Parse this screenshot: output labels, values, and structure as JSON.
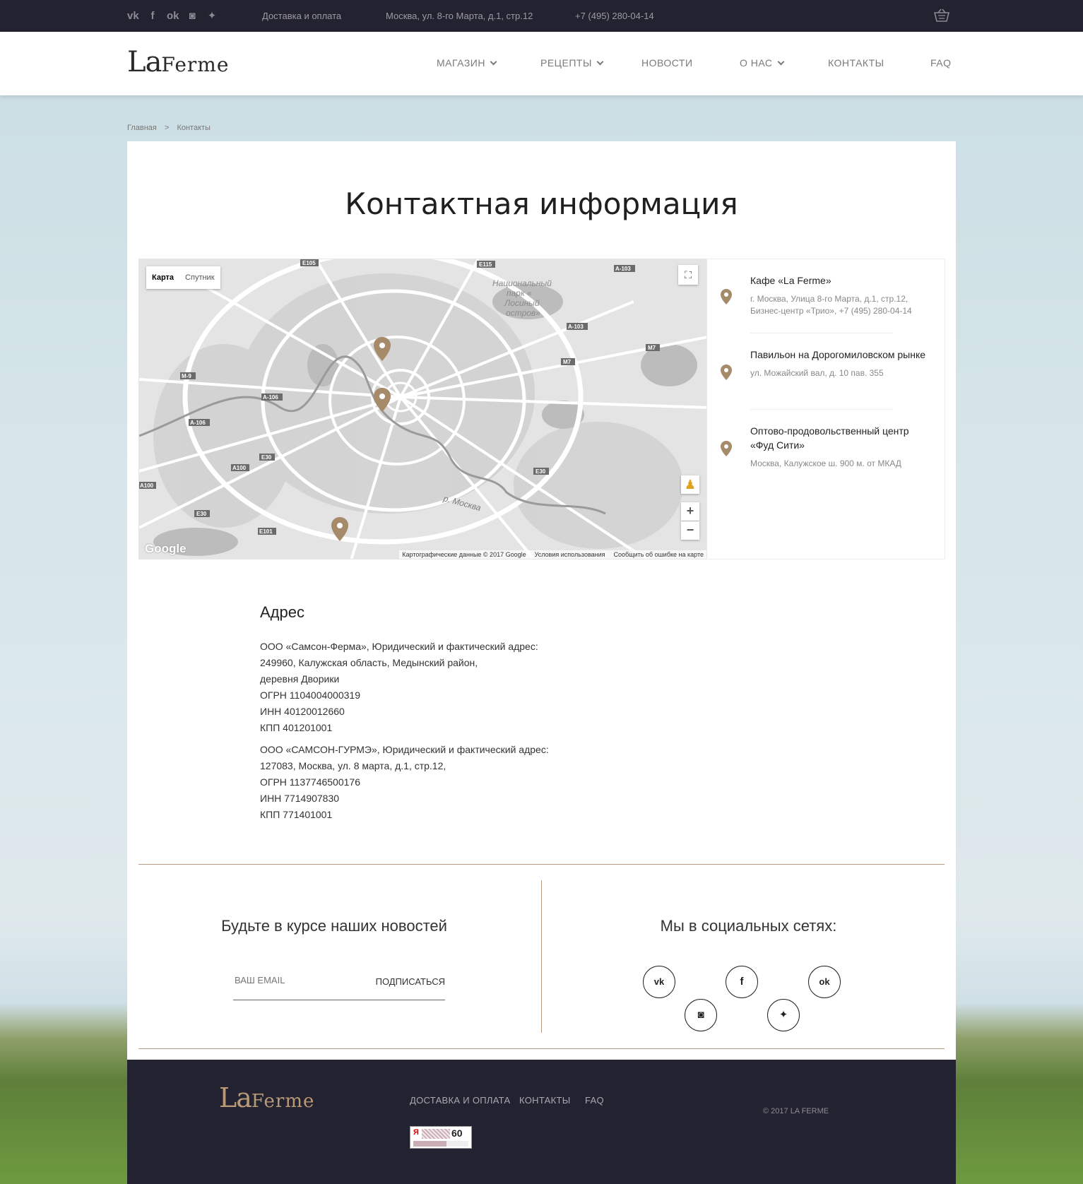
{
  "topbar": {
    "social_icons": [
      "vk-icon",
      "facebook-icon",
      "odnoklassniki-icon",
      "instagram-icon",
      "twitter-icon"
    ],
    "social_glyphs": {
      "vk": "vk",
      "facebook": "f",
      "odnoklassniki": "ok",
      "instagram": "◙",
      "twitter": "✦"
    },
    "delivery_link": "Доставка и оплата",
    "address": "Москва, ул. 8-го Марта, д.1, стр.12",
    "phone": "+7 (495) 280-04-14",
    "cart_icon": "basket-icon"
  },
  "header": {
    "logo_la": "La",
    "logo_ferme": "Ferme",
    "nav": [
      {
        "label": "МАГАЗИН",
        "dropdown": true
      },
      {
        "label": "РЕЦЕПТЫ",
        "dropdown": true
      },
      {
        "label": "НОВОСТИ",
        "dropdown": false
      },
      {
        "label": "О НАС",
        "dropdown": true
      },
      {
        "label": "КОНТАКТЫ",
        "dropdown": false
      },
      {
        "label": "FAQ",
        "dropdown": false
      }
    ]
  },
  "breadcrumb": {
    "home": "Главная",
    "separator": ">",
    "current": "Контакты"
  },
  "page": {
    "title": "Контактная информация"
  },
  "map": {
    "tab_map": "Карта",
    "tab_satellite": "Спутник",
    "google_logo": "Google",
    "credits": {
      "data": "Картографические данные © 2017 Google",
      "terms": "Условия использования",
      "report": "Сообщить об ошибке на карте"
    },
    "labels": {
      "park": "Национальный парк «Лосиный остров»",
      "river": "р. Москва"
    },
    "road_labels": [
      "E105",
      "E115",
      "A-103",
      "A-103",
      "M7",
      "M7",
      "M-9",
      "A-106",
      "A-106",
      "E30",
      "A100",
      "A100",
      "E30",
      "E101",
      "E30"
    ],
    "zoom_in": "+",
    "zoom_out": "−"
  },
  "locations": [
    {
      "name": "Кафе «La Ferme»",
      "address": "г. Москва, Улица 8-го Марта, д.1, стр.12, Бизнес-центр «Трио», +7 (495) 280-04-14"
    },
    {
      "name": "Павильон на Дорогомиловском рынке",
      "address": "ул. Можайский вал, д. 10 пав. 355"
    },
    {
      "name": "Оптово-продовольственный центр «Фуд Сити»",
      "address": "Москва, Калужское ш. 900 м. от МКАД"
    }
  ],
  "address_section": {
    "heading": "Адрес",
    "company1": [
      "ООО «Самсон-Ферма»,  Юридический и фактический адрес:",
      "249960, Калужская область, Медынский район,",
      "деревня Дворики",
      "ОГРН 1104004000319",
      "ИНН 40120012660",
      "КПП 401201001"
    ],
    "company2": [
      "ООО «САМСОН-ГУРМЭ»,  Юридический и фактический адрес:",
      "127083, Москва, ул. 8 марта, д.1, стр.12,",
      "ОГРН 1137746500176",
      "ИНН 7714907830",
      "КПП 771401001"
    ]
  },
  "subscribe": {
    "title": "Будьте в курсе наших новостей",
    "placeholder": "ВАШ EMAIL",
    "button": "ПОДПИСАТЬСЯ"
  },
  "social": {
    "title": "Мы в социальных сетях:",
    "icons": [
      "vk-icon",
      "facebook-icon",
      "odnoklassniki-icon",
      "instagram-icon",
      "twitter-icon"
    ],
    "glyphs": {
      "vk": "vk",
      "facebook": "f",
      "odnoklassniki": "ok",
      "instagram": "◙",
      "twitter": "✦"
    }
  },
  "footer": {
    "logo_la": "La",
    "logo_ferme": "Ferme",
    "links": [
      "ДОСТАВКА И ОПЛАТА",
      "КОНТАКТЫ",
      "FAQ"
    ],
    "copyright": "© 2017 LA FERME",
    "counter": {
      "mark": "Я",
      "value": "60"
    }
  },
  "colors": {
    "dark": "#232230",
    "accent": "#b49a80",
    "pin": "#a68b6b"
  }
}
